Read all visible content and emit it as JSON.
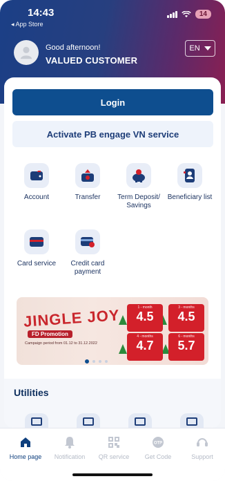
{
  "status": {
    "time": "14:43",
    "back_label": "◂ App Store",
    "battery": "14"
  },
  "header": {
    "greeting": "Good afternoon!",
    "user_name": "VALUED CUSTOMER",
    "language": "EN"
  },
  "actions": {
    "login_label": "Login",
    "activate_label": "Activate PB engage VN service"
  },
  "services": [
    {
      "label": "Account",
      "icon": "wallet-icon"
    },
    {
      "label": "Transfer",
      "icon": "transfer-icon"
    },
    {
      "label": "Term Deposit/ Savings",
      "icon": "piggy-bank-icon"
    },
    {
      "label": "Beneficiary list",
      "icon": "contact-book-icon"
    },
    {
      "label": "Card service",
      "icon": "card-icon"
    },
    {
      "label": "Credit card payment",
      "icon": "credit-card-payment-icon"
    }
  ],
  "banner": {
    "title": "JINGLE JOY",
    "subtitle": "FD Promotion",
    "note": "Campaign period from 01.12 to 31.12.2022",
    "rates": [
      {
        "term": "1 - month",
        "value": "4.5"
      },
      {
        "term": "3 - months",
        "value": "4.5"
      },
      {
        "term": "4 - months",
        "value": "4.7"
      },
      {
        "term": "6 - months",
        "value": "5.7"
      }
    ],
    "pages": 4,
    "active_page": 1
  },
  "utilities": {
    "title": "Utilities"
  },
  "tabs": [
    {
      "label": "Home page",
      "icon": "home-icon",
      "active": true
    },
    {
      "label": "Notification",
      "icon": "bell-icon",
      "active": false
    },
    {
      "label": "QR service",
      "icon": "qr-code-icon",
      "active": false
    },
    {
      "label": "Get Code",
      "icon": "otp-icon",
      "active": false
    },
    {
      "label": "Support",
      "icon": "headset-icon",
      "active": false
    }
  ],
  "colors": {
    "primary": "#0e4e8f",
    "brand_red": "#d3202a",
    "header_start": "#1b3f86",
    "header_end": "#8a1f52"
  }
}
